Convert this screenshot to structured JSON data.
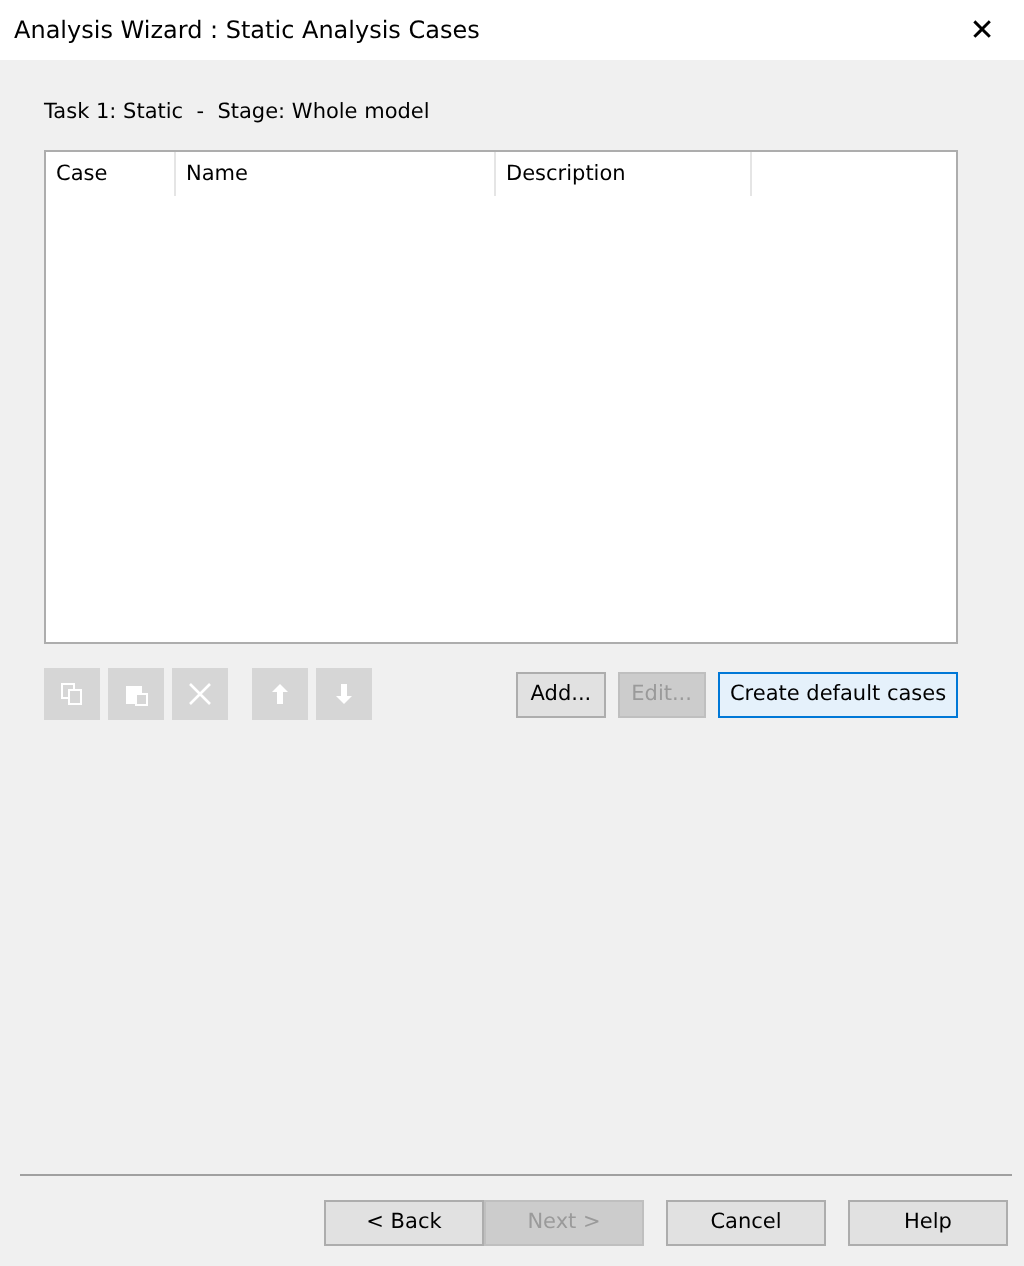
{
  "window": {
    "title": "Analysis Wizard : Static Analysis Cases",
    "close": "✕"
  },
  "task_label": "Task 1: Static  -  Stage: Whole model",
  "table": {
    "columns": [
      "Case",
      "Name",
      "Description"
    ]
  },
  "tools": [
    {
      "kind": "copy",
      "disabled": true
    },
    {
      "kind": "paste",
      "disabled": true
    },
    {
      "kind": "delete",
      "disabled": true
    },
    {
      "kind": "up",
      "disabled": true
    },
    {
      "kind": "down",
      "disabled": true
    }
  ],
  "actions": [
    {
      "label": "Add...",
      "disabled": false,
      "default": false
    },
    {
      "label": "Edit...",
      "disabled": true,
      "default": false
    },
    {
      "label": "Create default cases",
      "disabled": false,
      "default": true
    }
  ],
  "footer": [
    {
      "label": "< Back",
      "disabled": false
    },
    {
      "label": "Next >",
      "disabled": true
    },
    {
      "label": "Cancel",
      "disabled": false
    },
    {
      "label": "Help",
      "disabled": false
    }
  ]
}
